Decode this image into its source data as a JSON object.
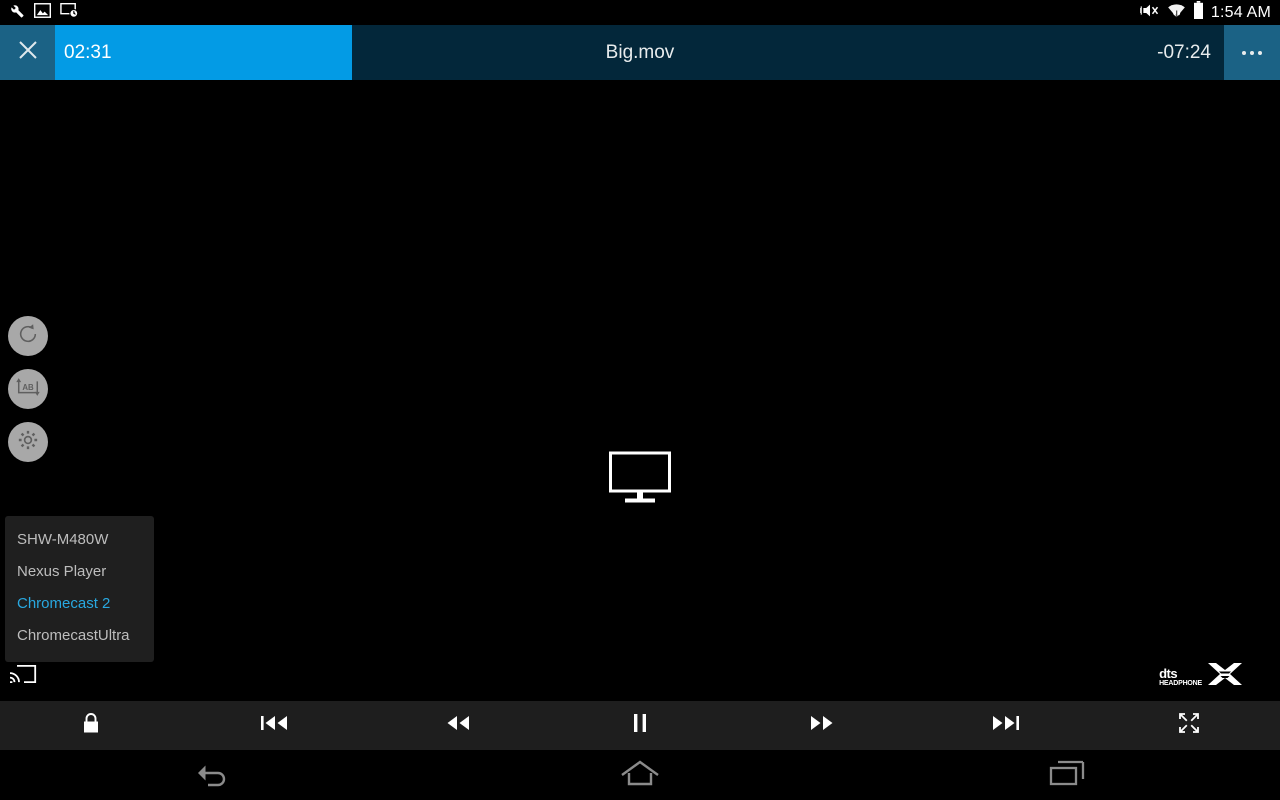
{
  "statusbar": {
    "icons_left": [
      "wrench-icon",
      "gallery-icon",
      "screen-timeout-icon"
    ],
    "icons_right": [
      "volume-mute-icon",
      "wifi-icon",
      "battery-icon"
    ],
    "clock": "1:54 AM"
  },
  "titlebar": {
    "close_label": "close-icon",
    "elapsed": "02:31",
    "title": "Big.mov",
    "remaining": "-07:24",
    "more_label": "overflow-menu",
    "progress_percent": 25.6,
    "accent_color": "#039be5",
    "bar_color": "#03273a",
    "button_color": "#1b6285"
  },
  "side_buttons": [
    {
      "name": "rotate-icon",
      "label": "Rotate"
    },
    {
      "name": "ab-repeat-icon",
      "label": "A-B Repeat"
    },
    {
      "name": "settings-gear-icon",
      "label": "Settings"
    }
  ],
  "cast": {
    "icon": "cast-icon",
    "center_icon": "monitor-icon",
    "devices": [
      {
        "label": "SHW-M480W",
        "selected": false
      },
      {
        "label": "Nexus Player",
        "selected": false
      },
      {
        "label": "Chromecast 2",
        "selected": true
      },
      {
        "label": "ChromecastUltra",
        "selected": false
      }
    ],
    "selected_color": "#29a8e0"
  },
  "audio_badge": {
    "line1": "dts",
    "line2": "HEADPHONE"
  },
  "controls": [
    {
      "name": "lock-icon",
      "label": "Lock"
    },
    {
      "name": "previous-track-icon",
      "label": "Previous"
    },
    {
      "name": "rewind-icon",
      "label": "Rewind"
    },
    {
      "name": "pause-icon",
      "label": "Pause"
    },
    {
      "name": "fast-forward-icon",
      "label": "Fast Forward"
    },
    {
      "name": "next-track-icon",
      "label": "Next"
    },
    {
      "name": "fullscreen-icon",
      "label": "Fullscreen"
    }
  ],
  "navbar": [
    {
      "name": "back-icon",
      "label": "Back"
    },
    {
      "name": "home-icon",
      "label": "Home"
    },
    {
      "name": "recents-icon",
      "label": "Recent Apps"
    }
  ]
}
